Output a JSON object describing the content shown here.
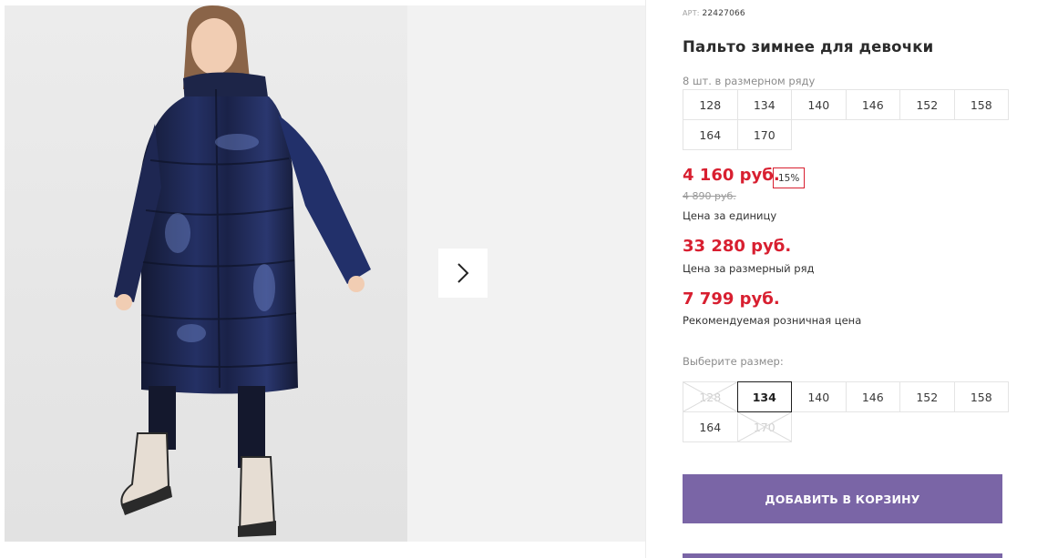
{
  "gallery": {
    "next_icon": "chevron-right-icon"
  },
  "product": {
    "article_label": "АРТ:",
    "article_value": "22427066",
    "title": "Пальто зимнее для девочки",
    "size_row_caption": "8 шт. в размерном ряду",
    "size_row": [
      "128",
      "134",
      "140",
      "146",
      "152",
      "158",
      "164",
      "170"
    ],
    "price_unit": "4 160 руб.",
    "discount": "15%",
    "old_price": "4 890 руб.",
    "price_unit_note": "Цена за единицу",
    "price_row": "33 280 руб.",
    "price_row_note": "Цена за размерный ряд",
    "price_retail": "7 799 руб.",
    "price_retail_note": "Рекомендуемая розничная цена",
    "choose_size_caption": "Выберите размер:",
    "size_options": [
      {
        "label": "128",
        "state": "disabled"
      },
      {
        "label": "134",
        "state": "selected"
      },
      {
        "label": "140",
        "state": "available"
      },
      {
        "label": "146",
        "state": "available"
      },
      {
        "label": "152",
        "state": "available"
      },
      {
        "label": "158",
        "state": "available"
      },
      {
        "label": "164",
        "state": "available"
      },
      {
        "label": "170",
        "state": "disabled"
      }
    ],
    "add_to_cart": "ДОБАВИТЬ В КОРЗИНУ"
  },
  "colors": {
    "price_red": "#d81f30",
    "button_purple": "#7a65a6",
    "coat_navy": "#1b2140"
  }
}
